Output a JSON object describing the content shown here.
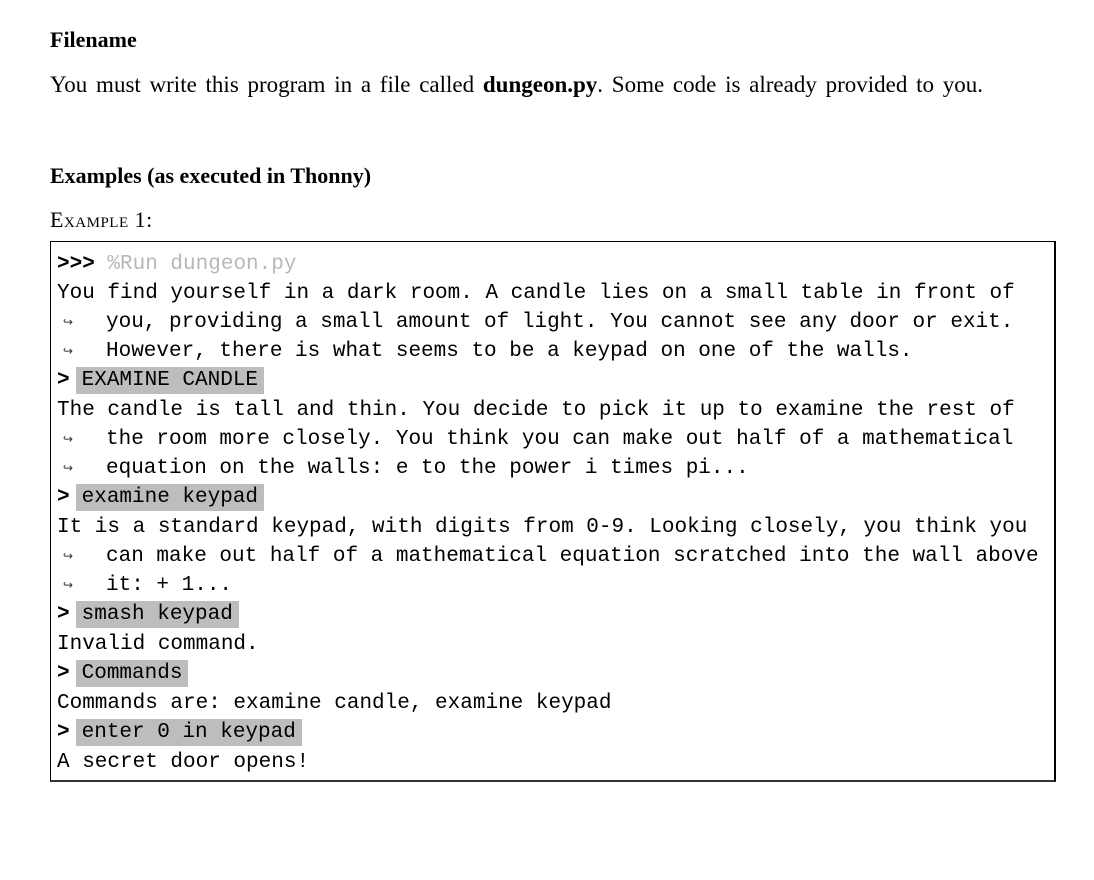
{
  "section_filename": {
    "heading": "Filename",
    "text_before": "You must write this program in a file called ",
    "filename": "dungeon.py",
    "text_after": ".  Some code is already provided to you."
  },
  "section_examples": {
    "heading": "Examples (as executed in Thonny)",
    "example_label": "Example 1:"
  },
  "console": {
    "run_prompt": ">>>",
    "run_command": "%Run dungeon.py",
    "continuation_glyph": "↪",
    "input_prompt": ">",
    "lines": [
      {
        "type": "output",
        "text": "You find yourself in a dark room. A candle lies on a small table in front of"
      },
      {
        "type": "continuation",
        "text": "you, providing a small amount of light. You cannot see any door or exit."
      },
      {
        "type": "continuation",
        "text": "However, there is what seems to be a keypad on one of the walls."
      },
      {
        "type": "input",
        "text": "EXAMINE CANDLE"
      },
      {
        "type": "output",
        "text": "The candle is tall and thin. You decide to pick it up to examine the rest of"
      },
      {
        "type": "continuation",
        "text": "the room more closely. You think you can make out half of a mathematical"
      },
      {
        "type": "continuation",
        "text": "equation on the walls: e to the power i times pi..."
      },
      {
        "type": "input",
        "text": "examine keypad"
      },
      {
        "type": "output",
        "text": "It is a standard keypad, with digits from 0-9. Looking closely, you think you"
      },
      {
        "type": "continuation",
        "text": "can make out half of a mathematical equation scratched into the wall above"
      },
      {
        "type": "continuation",
        "text": "it: + 1..."
      },
      {
        "type": "input",
        "text": "smash keypad"
      },
      {
        "type": "output",
        "text": "Invalid command."
      },
      {
        "type": "input",
        "text": "Commands"
      },
      {
        "type": "output",
        "text": "Commands are: examine candle, examine keypad"
      },
      {
        "type": "input",
        "text": "enter 0 in keypad"
      },
      {
        "type": "output",
        "text": "A secret door opens!"
      }
    ]
  }
}
